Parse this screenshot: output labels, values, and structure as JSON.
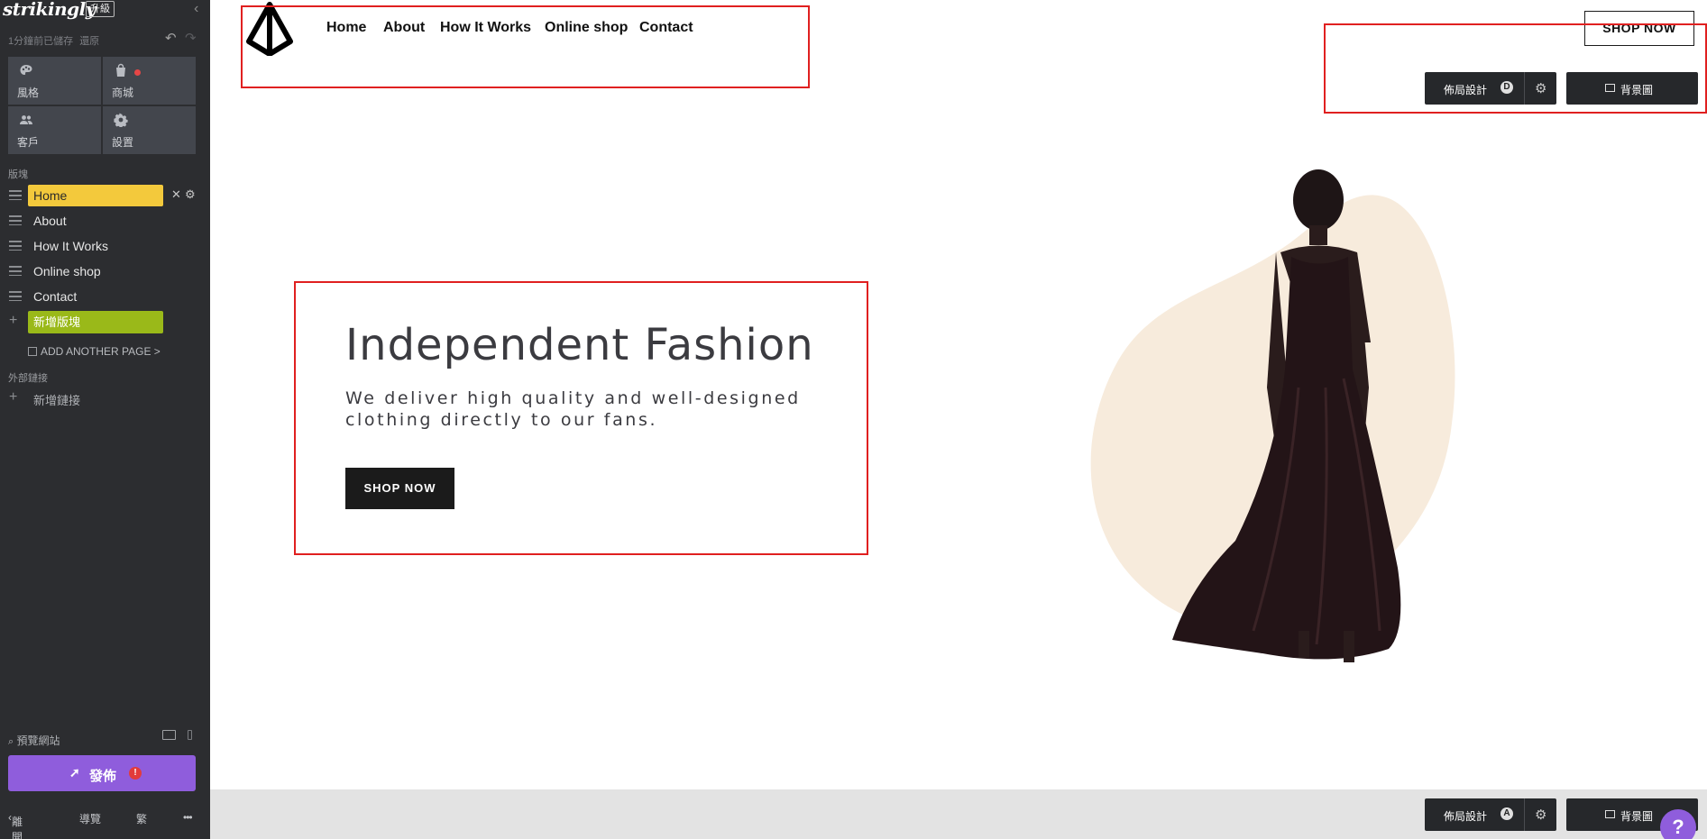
{
  "editor": {
    "brand": "strikingly",
    "upgrade": "升級",
    "autosave": "1分鐘前已儲存",
    "autosave_link": "還原",
    "tiles": [
      {
        "label": "風格",
        "icon": "palette-icon"
      },
      {
        "label": "商城",
        "icon": "shopping-bag-icon"
      },
      {
        "label": "客戶",
        "icon": "people-icon"
      },
      {
        "label": "設置",
        "icon": "gear-icon"
      }
    ],
    "sections_heading": "版塊",
    "blocks": [
      {
        "label": "Home",
        "active": true
      },
      {
        "label": "About",
        "active": false
      },
      {
        "label": "How It Works",
        "active": false
      },
      {
        "label": "Online shop",
        "active": false
      },
      {
        "label": "Contact",
        "active": false
      }
    ],
    "add_block": "新增版塊",
    "add_page": "ADD ANOTHER PAGE >",
    "external_heading": "外部鏈接",
    "add_link": "新增鏈接",
    "preview": "預覽網站",
    "publish": "發佈",
    "publish_warning": "!",
    "footer": {
      "back": "離開",
      "guide": "導覽",
      "lang": "繁",
      "more": "•••"
    },
    "accent_color": "#8f5ddc",
    "active_block_color": "#f3c93c",
    "add_block_color": "#9ab919"
  },
  "site": {
    "nav": [
      "Home",
      "About",
      "How It Works",
      "Online shop",
      "Contact"
    ],
    "header_cta": "SHOP NOW",
    "hero": {
      "title": "Independent Fashion",
      "subtitle": "We deliver high quality and well-designed clothing directly to our fans.",
      "cta": "SHOP NOW"
    },
    "section_toolbar": {
      "layout": "佈局設計",
      "layout_badge": "D",
      "background": "背景圖"
    },
    "next_section_toolbar": {
      "layout": "佈局設計",
      "layout_badge": "A",
      "background": "背景圖"
    },
    "highlight_color": "#e02020"
  },
  "help": "?"
}
